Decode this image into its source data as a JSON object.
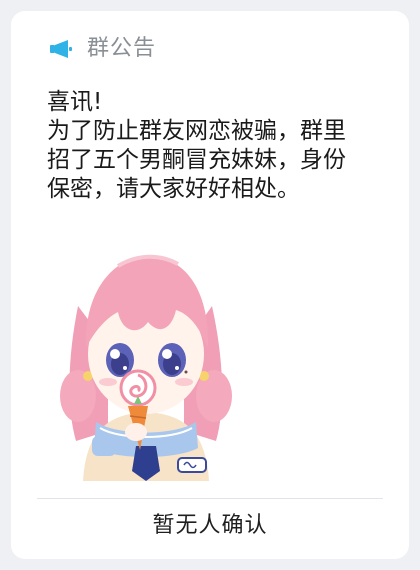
{
  "announcement": {
    "header_title": "群公告",
    "header_icon": "megaphone-icon",
    "accent_color": "#2fb3e6",
    "body_lines": [
      "喜讯!",
      "为了防止群友网恋被骗，群里",
      "招了五个男酮冒充妹妹，身份",
      "保密，请大家好好相处。"
    ],
    "image": "anime-girl-holding-lollipop-illustration",
    "footer_text": "暂无人确认"
  }
}
